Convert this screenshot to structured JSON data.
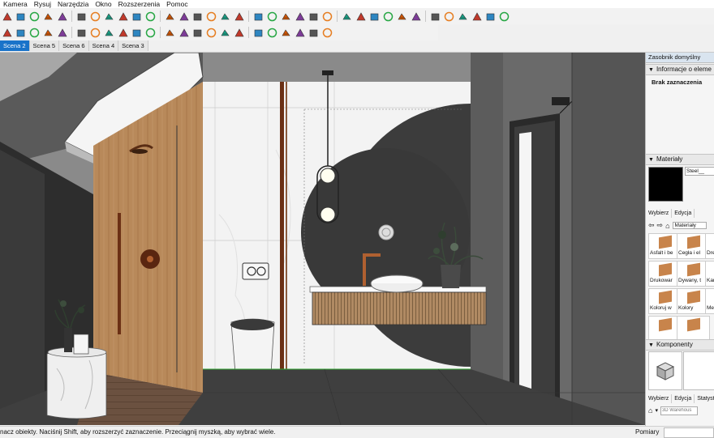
{
  "menu": [
    "Kamera",
    "Rysuj",
    "Narzędzia",
    "Okno",
    "Rozszerzenia",
    "Pomoc"
  ],
  "scenes": [
    {
      "label": "Scena 2",
      "active": true
    },
    {
      "label": "Scena 5",
      "active": false
    },
    {
      "label": "Scena 6",
      "active": false
    },
    {
      "label": "Scena 4",
      "active": false
    },
    {
      "label": "Scena 3",
      "active": false
    }
  ],
  "tray": {
    "title": "Zasobnik domyślny",
    "entity_info": {
      "header": "Informacje o eleme",
      "status": "Brak zaznaczenia"
    },
    "materials": {
      "header": "Materiały",
      "current_name": "Steel__",
      "current_color": "#000000",
      "tabs": [
        "Wybierz",
        "Edycja"
      ],
      "library": "Materiały",
      "items": [
        "Asfalt i be",
        "Cegła i el",
        "Dre",
        "Drukowar",
        "Dywany, t",
        "Kan",
        "Koloruj w",
        "Kolory",
        "Met",
        "",
        ""
      ]
    },
    "components": {
      "header": "Komponenty",
      "tabs": [
        "Wybierz",
        "Edycja",
        "Statysty"
      ],
      "search_placeholder": "3D Warehous"
    }
  },
  "status": {
    "message": "nacz obiekty. Naciśnij Shift, aby rozszerzyć zaznaczenie. Przeciągnij myszką, aby wybrać wiele.",
    "measure_label": "Pomiary"
  },
  "toolbar_row1": [
    "select-icon",
    "eraser-icon",
    "paint-icon",
    "move-icon",
    "rotate-icon",
    "scale-icon",
    "offset-icon",
    "pushpull-icon",
    "followme-icon",
    "tape-icon",
    "text-icon",
    "orbit-icon",
    "pan-icon",
    "zoom-icon",
    "zoom-extents-icon",
    "section-icon",
    "warehouse-icon",
    "extension-icon",
    "xray-icon",
    "wireframe-icon",
    "hidden-line-icon",
    "shaded-icon",
    "textured-icon",
    "monochrome-icon",
    "iso-icon",
    "top-icon",
    "front-icon",
    "right-icon",
    "back-icon",
    "left-icon",
    "shadow-icon",
    "fog-icon",
    "sun-icon",
    "camera-icon",
    "settings-icon"
  ],
  "toolbar_row2": [
    "layer-icon",
    "box-icon",
    "component-icon",
    "group-icon",
    "house-icon",
    "home-icon",
    "lock-icon",
    "unlock-icon",
    "material-icon",
    "axis-icon",
    "paint2-icon",
    "pin-icon",
    "tag-icon",
    "mirror-icon",
    "align-icon",
    "magnet-icon",
    "curve-icon",
    "arc-icon",
    "flag-icon",
    "sphere-icon",
    "pattern-icon",
    "star-icon",
    "line-tool-icon"
  ]
}
